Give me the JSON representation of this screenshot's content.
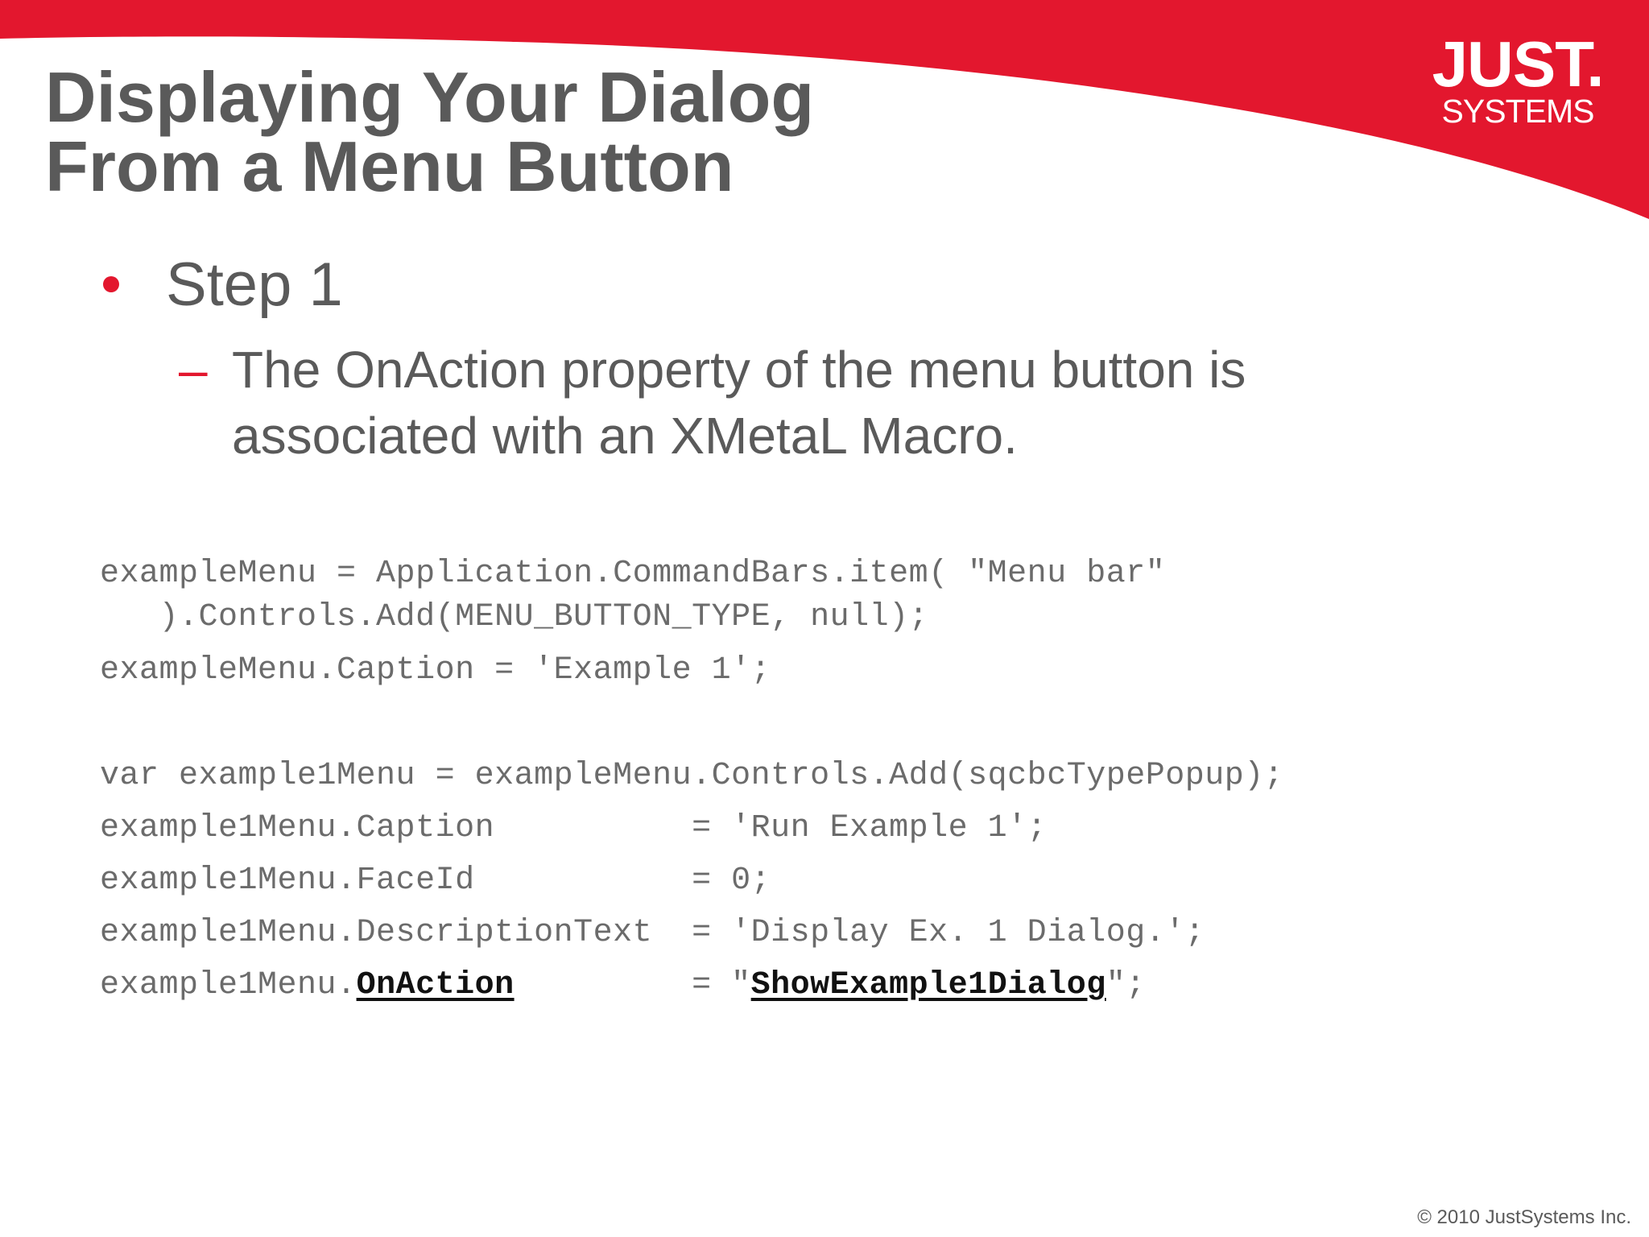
{
  "logo": {
    "main": "JUST.",
    "sub": "SYSTEMS"
  },
  "title": {
    "line1": "Displaying Your Dialog",
    "line2": "From a Menu Button"
  },
  "bullet": {
    "text": "Step 1"
  },
  "sub_bullet": {
    "marker": "–",
    "line1": "The OnAction property of the menu button is",
    "line2": "associated with an XMetaL Macro."
  },
  "code": {
    "line1": "exampleMenu = Application.CommandBars.item( \"Menu bar\"",
    "line2": "   ).Controls.Add(MENU_BUTTON_TYPE, null);",
    "line3": "exampleMenu.Caption = 'Example 1';",
    "line4": "var example1Menu = exampleMenu.Controls.Add(sqcbcTypePopup);",
    "line5": "example1Menu.Caption          = 'Run Example 1';",
    "line6": "example1Menu.FaceId           = 0;",
    "line7": "example1Menu.DescriptionText  = 'Display Ex. 1 Dialog.';",
    "line8_prefix": "example1Menu.",
    "line8_property": "OnAction",
    "line8_mid": "         = \"",
    "line8_value": "ShowExample1Dialog",
    "line8_suffix": "\";"
  },
  "footer": {
    "copyright": "© 2010 JustSystems Inc."
  },
  "colors": {
    "brand_red": "#e3172e",
    "title_gray": "#5a5a5a",
    "code_gray": "#6b6b6b"
  }
}
